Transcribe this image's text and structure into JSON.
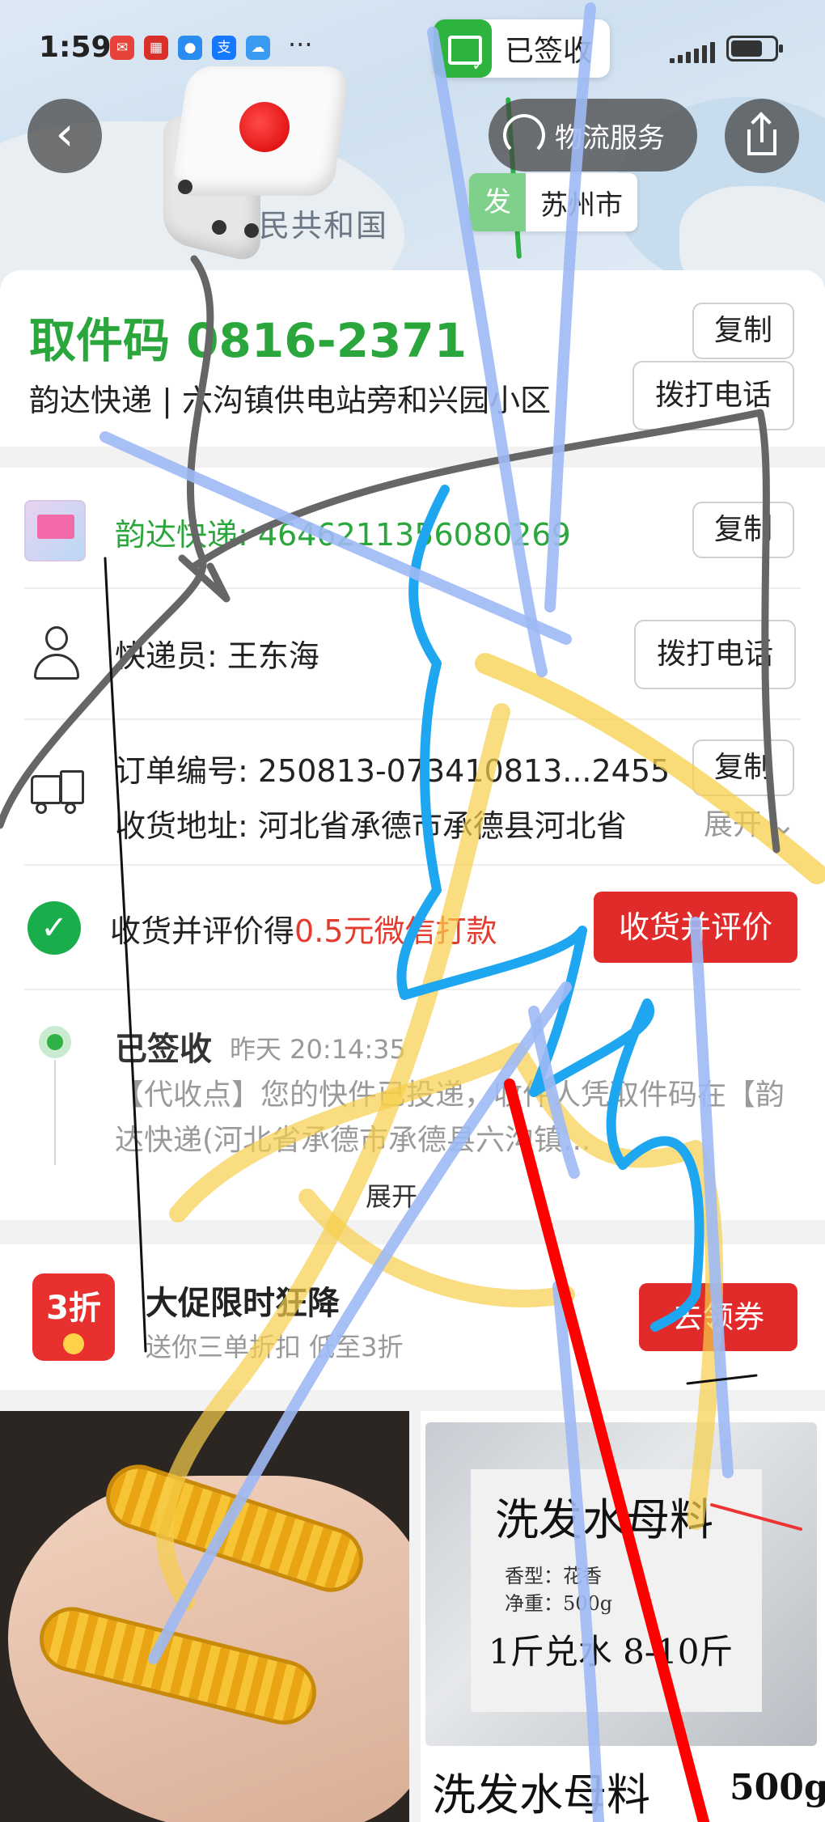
{
  "status_bar": {
    "time": "1:59",
    "more": "···",
    "apps": [
      {
        "name": "app-red-icon",
        "glyph": "✉",
        "color": "#e8433a"
      },
      {
        "name": "app-huawei-icon",
        "glyph": "▦",
        "color": "#d9302a"
      },
      {
        "name": "app-message-icon",
        "glyph": "●",
        "color": "#2b8cf0"
      },
      {
        "name": "alipay-icon",
        "glyph": "支",
        "color": "#1677ff"
      },
      {
        "name": "cloud-icon",
        "glyph": "☁",
        "color": "#3a9af2"
      }
    ]
  },
  "map": {
    "signed_badge": "已签收",
    "logistics_service": "物流服务",
    "origin_tag": "发",
    "origin_city": "苏州市",
    "country_label": "民共和国"
  },
  "pickup": {
    "code": "取件码 0816-2371",
    "address": "韵达快递 | 六沟镇供电站旁和兴园小区",
    "copy_label": "复制",
    "call_label": "拨打电话"
  },
  "shipment": {
    "carrier_tracking": "韵达快递: 4646211356080269",
    "copy_label": "复制",
    "courier": "快递员:  王东海",
    "call_label": "拨打电话",
    "order_no": "订单编号: 250813-073410813...2455",
    "order_copy": "复制",
    "address": "收货地址: 河北省承德市承德县河北省",
    "expand_label": "展开"
  },
  "promo": {
    "text_prefix": "收货并评价得",
    "text_highlight": "0.5元微信打款",
    "button": "收货并评价"
  },
  "timeline": {
    "status": "已签收",
    "time": "昨天 20:14:35",
    "desc": "【代收点】您的快件已投递，收件人凭取件码在【韵达快递(河北省承德市承德县六沟镇...",
    "expand": "展开"
  },
  "sale": {
    "badge": "3折",
    "title": "大促限时狂降",
    "subtitle": "送你三单折扣 低至3折",
    "button": "去领券"
  },
  "products": {
    "shampoo_label_title": "洗发水母料",
    "shampoo_label_scent": "香型：花香",
    "shampoo_label_weight": "净重：500g",
    "shampoo_label_ratio": "1斤兑水 8-10斤",
    "shampoo_caption": "洗发水母料",
    "shampoo_weight": "500g"
  },
  "colors": {
    "brand_green": "#2aa63c",
    "button_red": "#e12b2b",
    "scribble_blue": "#9db9f5",
    "scribble_cyan": "#1ea7f0",
    "scribble_yellow": "#f7cf4a",
    "scribble_gray": "#666666",
    "scribble_red": "#ff0000"
  }
}
